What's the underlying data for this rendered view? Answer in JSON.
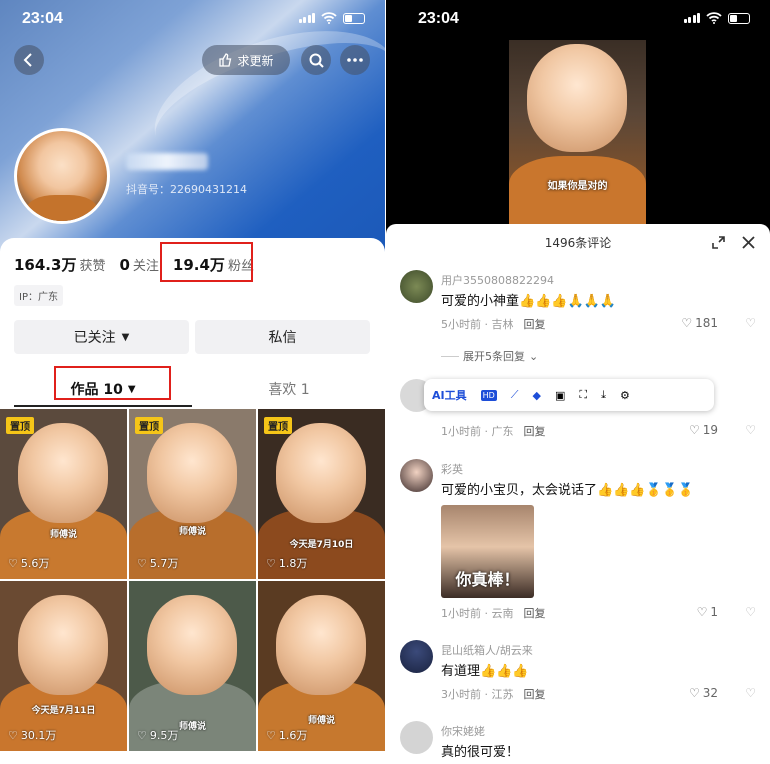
{
  "status_bar": {
    "time": "23:04"
  },
  "profile": {
    "follow_update_label": "求更新",
    "uid_text": "抖音号：22690431214",
    "stats": [
      {
        "value": "164.3万",
        "label": "获赞"
      },
      {
        "value": "0",
        "label": "关注"
      },
      {
        "value": "19.4万",
        "label": "粉丝"
      }
    ],
    "ip": "IP：广东",
    "followed_label": "已关注",
    "message_label": "私信",
    "tab_works": "作品 10",
    "tab_likes": "喜欢 1",
    "pinned_label": "置顶",
    "videos": [
      {
        "likes": "5.6万",
        "caption": "师傅说",
        "pinned": true
      },
      {
        "likes": "5.7万",
        "caption": "师傅说",
        "pinned": true
      },
      {
        "likes": "1.8万",
        "caption": "今天是7月10日",
        "pinned": true
      },
      {
        "likes": "30.1万",
        "caption": "今天是7月11日",
        "pinned": false
      },
      {
        "likes": "9.5万",
        "caption": "师傅说",
        "pinned": false
      },
      {
        "likes": "1.6万",
        "caption": "师傅说",
        "pinned": false
      }
    ]
  },
  "video": {
    "caption": "如果你是对的"
  },
  "comments_panel": {
    "title": "1496条评论",
    "expand_label": "展开5条回复",
    "reply_label": "回复",
    "toolbar": {
      "ai_label": "AI工具"
    },
    "comments": [
      {
        "user": "用户3550808822294",
        "text": "可爱的小神童👍👍👍🙏🙏🙏",
        "meta": "5小时前 · 吉林",
        "likes": "181"
      },
      {
        "user": "",
        "text": "",
        "meta": "1小时前 · 广东",
        "likes": "19"
      },
      {
        "user": "彩英",
        "text": "可爱的小宝贝，太会说话了👍👍👍🥇🥇🥇",
        "meta": "1小时前 · 云南",
        "likes": "1",
        "image_caption": "你真棒！"
      },
      {
        "user": "昆山纸箱人/胡云来",
        "text": "有道理👍👍👍",
        "meta": "3小时前 · 江苏",
        "likes": "32"
      },
      {
        "user": "你宋姥姥",
        "text": "真的很可爱！",
        "meta": "",
        "likes": ""
      }
    ]
  },
  "colors": {
    "highlight": "#e0201b",
    "hero_blue": "#1f5fc0",
    "pin_yellow": "#f5c518"
  }
}
